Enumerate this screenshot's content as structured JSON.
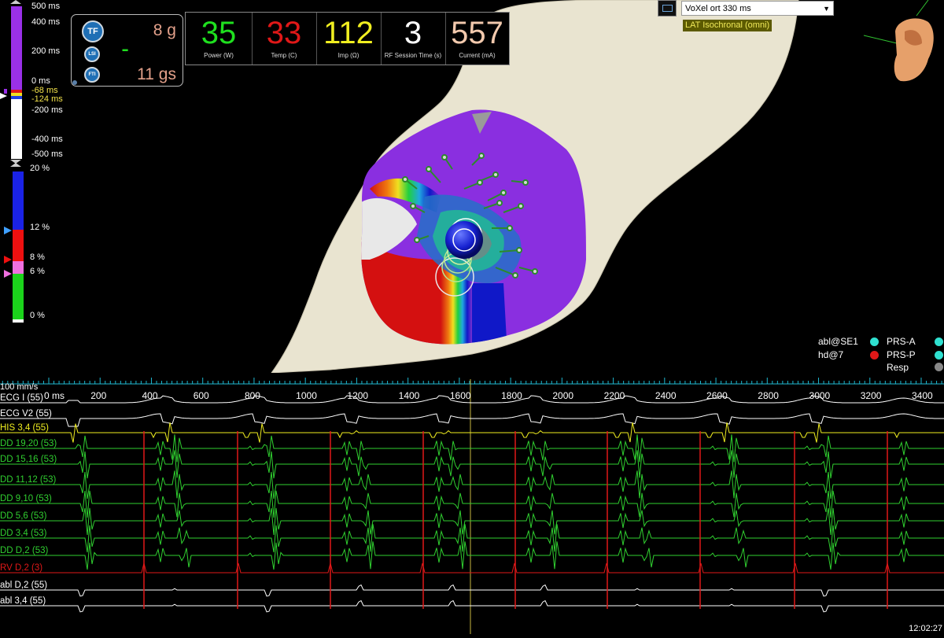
{
  "lat_scale": {
    "top_labels": [
      "500 ms",
      "400 ms",
      "200 ms",
      "0 ms",
      "-200 ms",
      "-400 ms",
      "-500 ms"
    ],
    "window_marker_upper": "-68 ms",
    "window_marker_lower": "-124 ms"
  },
  "volt_scale": {
    "labels": [
      "20 %",
      "12 %",
      "8 %",
      "6 %",
      "0 %"
    ],
    "colors": {
      "upper": "#1a22e6",
      "band_red": "#ee1010",
      "band_pink": "#f070e0",
      "lower": "#1bd31b"
    }
  },
  "contact_force": {
    "tf_badge": "TF",
    "lsi_badge": "LSI",
    "fti_badge": "FTI",
    "force_value": "8 g",
    "fti_value": "11 gs",
    "lsi_indicator": "▪▪▪▪"
  },
  "rf": [
    {
      "value": "35",
      "label": "Power (W)",
      "color": "#1fe01f"
    },
    {
      "value": "33",
      "label": "Temp (C)",
      "color": "#e01818"
    },
    {
      "value": "112",
      "label": "Imp (Ω)",
      "color": "#f0ee20"
    },
    {
      "value": "3",
      "label": "RF Session Time (s)",
      "color": "#ffffff"
    },
    {
      "value": "557",
      "label": "Current (mA)",
      "color": "#f2c9ad"
    }
  ],
  "map": {
    "dropdown_value": "VoXel ort 330 ms",
    "map_type": "LAT Isochronal (omni)"
  },
  "legend": {
    "left": [
      {
        "label": "abl@SE1",
        "color": "#2fe0d0"
      },
      {
        "label": "hd@7",
        "color": "#e01818"
      }
    ],
    "right": [
      {
        "label": "PRS-A",
        "color": "#2fe0d0"
      },
      {
        "label": "PRS-P",
        "color": "#2fe0d0"
      },
      {
        "label": "Resp",
        "color": "#888888"
      }
    ]
  },
  "timeline": {
    "sweep_speed": "100 mm/s",
    "tick_labels": [
      "0 ms",
      "200",
      "400",
      "600",
      "800",
      "1000",
      "1200",
      "1400",
      "1600",
      "1800",
      "2000",
      "2200",
      "2400",
      "2600",
      "2800",
      "3000",
      "3200",
      "3400"
    ]
  },
  "channels": [
    {
      "label": "ECG I (55)",
      "color": "#ffffff"
    },
    {
      "label": "ECG V2 (55)",
      "color": "#ffffff"
    },
    {
      "label": "HIS 3,4 (55)",
      "color": "#f0ee20"
    },
    {
      "label": "DD 19,20 (53)",
      "color": "#30d030"
    },
    {
      "label": "DD 15,16 (53)",
      "color": "#30d030"
    },
    {
      "label": "DD 11,12 (53)",
      "color": "#30d030"
    },
    {
      "label": "DD 9,10 (53)",
      "color": "#30d030"
    },
    {
      "label": "DD 5,6 (53)",
      "color": "#30d030"
    },
    {
      "label": "DD 3,4 (53)",
      "color": "#30d030"
    },
    {
      "label": "DD D,2 (53)",
      "color": "#30d030"
    },
    {
      "label": "RV D,2 (3)",
      "color": "#e01818"
    },
    {
      "label": "abl D,2 (55)",
      "color": "#ffffff"
    },
    {
      "label": "abl 3,4 (55)",
      "color": "#ffffff"
    }
  ],
  "clock": "12:02:27"
}
